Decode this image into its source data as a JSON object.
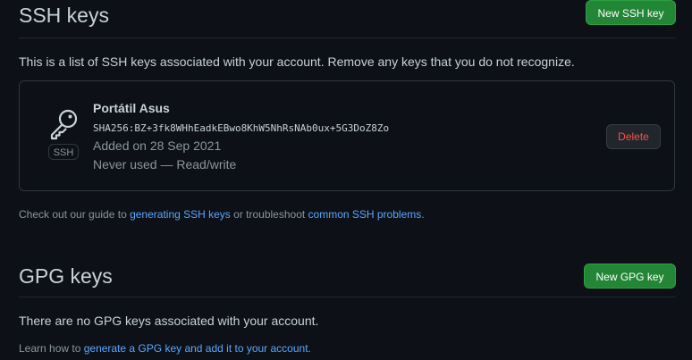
{
  "ssh": {
    "title": "SSH keys",
    "new_button": "New SSH key",
    "description": "This is a list of SSH keys associated with your account. Remove any keys that you do not recognize.",
    "keys": [
      {
        "name": "Portátil Asus",
        "type_badge": "SSH",
        "fingerprint": "SHA256:BZ+3fk8WHhEadkEBwo8KhW5NhRsNAb0ux+5G3DoZ8Zo",
        "added": "Added on 28 Sep 2021",
        "usage": "Never used — Read/write",
        "delete_label": "Delete"
      }
    ],
    "guide": {
      "prefix": "Check out our guide to ",
      "link1": "generating SSH keys",
      "middle": " or troubleshoot ",
      "link2": "common SSH problems",
      "suffix": "."
    }
  },
  "gpg": {
    "title": "GPG keys",
    "new_button": "New GPG key",
    "empty_message": "There are no GPG keys associated with your account.",
    "learn": {
      "prefix": "Learn how to ",
      "link": "generate a GPG key and add it to your account",
      "suffix": "."
    }
  },
  "colors": {
    "background": "#0d1117",
    "primary_button": "#238636",
    "danger": "#f85149",
    "link": "#58a6ff"
  }
}
